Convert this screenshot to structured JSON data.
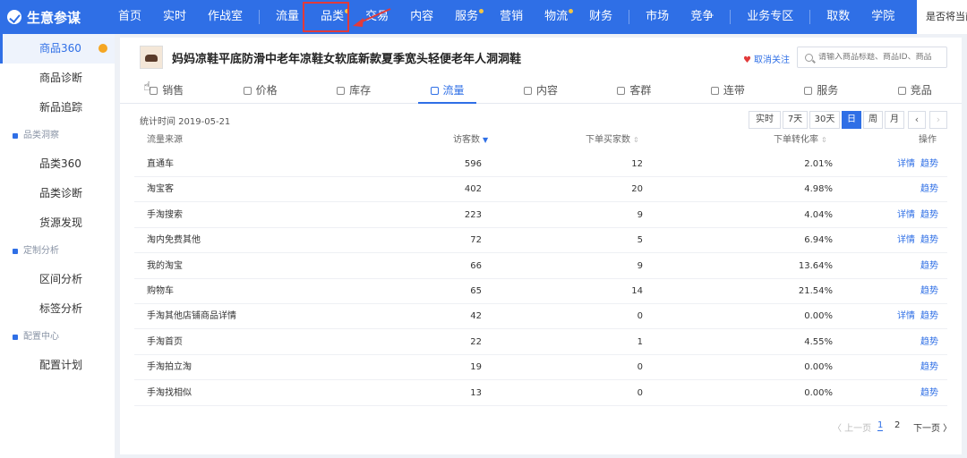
{
  "app": {
    "name": "生意参谋"
  },
  "nav": {
    "items": [
      {
        "label": "首页",
        "dot": false
      },
      {
        "label": "实时",
        "dot": false
      },
      {
        "label": "作战室",
        "dot": false
      },
      {
        "label": "流量",
        "dot": false
      },
      {
        "label": "品类",
        "dot": true
      },
      {
        "label": "交易",
        "dot": false
      },
      {
        "label": "内容",
        "dot": false
      },
      {
        "label": "服务",
        "dot": true
      },
      {
        "label": "营销",
        "dot": false
      },
      {
        "label": "物流",
        "dot": true
      },
      {
        "label": "财务",
        "dot": false
      },
      {
        "label": "市场",
        "dot": false
      },
      {
        "label": "竞争",
        "dot": false
      },
      {
        "label": "业务专区",
        "dot": false
      },
      {
        "label": "取数",
        "dot": false
      },
      {
        "label": "学院",
        "dot": false
      }
    ],
    "right_text": "是否将当前"
  },
  "sidebar": {
    "items": [
      {
        "label": "商品360",
        "type": "item",
        "active": true
      },
      {
        "label": "商品诊断",
        "type": "item"
      },
      {
        "label": "新品追踪",
        "type": "item"
      },
      {
        "label": "品类洞察",
        "type": "group"
      },
      {
        "label": "品类360",
        "type": "item"
      },
      {
        "label": "品类诊断",
        "type": "item"
      },
      {
        "label": "货源发现",
        "type": "item"
      },
      {
        "label": "定制分析",
        "type": "group"
      },
      {
        "label": "区间分析",
        "type": "item"
      },
      {
        "label": "标签分析",
        "type": "item"
      },
      {
        "label": "配置中心",
        "type": "group"
      },
      {
        "label": "配置计划",
        "type": "item"
      }
    ]
  },
  "product": {
    "title": "妈妈凉鞋平底防滑中老年凉鞋女软底新款夏季宽头轻便老年人洞洞鞋",
    "follow_label": "取消关注",
    "search_placeholder": "请输入商品标题、商品ID、商品"
  },
  "tabs": [
    "销售",
    "价格",
    "库存",
    "流量",
    "内容",
    "客群",
    "连带",
    "服务",
    "竞品"
  ],
  "active_tab": "流量",
  "stat_time": "统计时间 2019-05-21",
  "periods": [
    "实时",
    "7天",
    "30天",
    "日",
    "周",
    "月"
  ],
  "active_period": "日",
  "table": {
    "headers": [
      "流量来源",
      "访客数",
      "下单买家数",
      "下单转化率",
      "操作"
    ],
    "rows": [
      {
        "source": "直通车",
        "visitors": "596",
        "buyers": "12",
        "rate": "2.01%",
        "detail": "详情",
        "trend": "趋势"
      },
      {
        "source": "淘宝客",
        "visitors": "402",
        "buyers": "20",
        "rate": "4.98%",
        "detail": "",
        "trend": "趋势"
      },
      {
        "source": "手淘搜索",
        "visitors": "223",
        "buyers": "9",
        "rate": "4.04%",
        "detail": "详情",
        "trend": "趋势"
      },
      {
        "source": "淘内免费其他",
        "visitors": "72",
        "buyers": "5",
        "rate": "6.94%",
        "detail": "详情",
        "trend": "趋势"
      },
      {
        "source": "我的淘宝",
        "visitors": "66",
        "buyers": "9",
        "rate": "13.64%",
        "detail": "",
        "trend": "趋势"
      },
      {
        "source": "购物车",
        "visitors": "65",
        "buyers": "14",
        "rate": "21.54%",
        "detail": "",
        "trend": "趋势"
      },
      {
        "source": "手淘其他店铺商品详情",
        "visitors": "42",
        "buyers": "0",
        "rate": "0.00%",
        "detail": "详情",
        "trend": "趋势"
      },
      {
        "source": "手淘首页",
        "visitors": "22",
        "buyers": "1",
        "rate": "4.55%",
        "detail": "",
        "trend": "趋势"
      },
      {
        "source": "手淘拍立淘",
        "visitors": "19",
        "buyers": "0",
        "rate": "0.00%",
        "detail": "",
        "trend": "趋势"
      },
      {
        "source": "手淘找相似",
        "visitors": "13",
        "buyers": "0",
        "rate": "0.00%",
        "detail": "",
        "trend": "趋势"
      }
    ]
  },
  "pagination": {
    "prev": "〈 上一页",
    "pages": [
      "1",
      "2"
    ],
    "current": "1",
    "next": "下一页 〉"
  },
  "colors": {
    "brand": "#2f6fe6",
    "highlight": "#e23a3a"
  }
}
